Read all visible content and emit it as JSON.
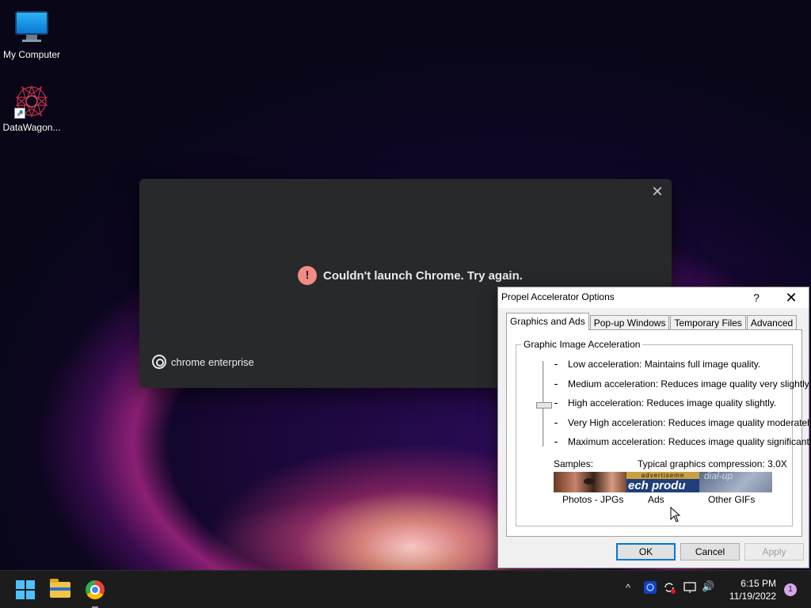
{
  "desktop": {
    "icons": [
      {
        "label": "My Computer",
        "icon": "monitor-icon"
      },
      {
        "label": "DataWagon...",
        "icon": "datawagon-icon"
      }
    ]
  },
  "chrome_error": {
    "message": "Couldn't launch Chrome. Try again.",
    "brand": "chrome enterprise",
    "close": "✕",
    "error_glyph": "!"
  },
  "propel": {
    "title": "Propel Accelerator Options",
    "help": "?",
    "close": "✕",
    "tabs": [
      {
        "label": "Graphics and Ads",
        "active": true
      },
      {
        "label": "Pop-up Windows",
        "active": false
      },
      {
        "label": "Temporary Files",
        "active": false
      },
      {
        "label": "Advanced",
        "active": false
      }
    ],
    "group_title": "Graphic Image Acceleration",
    "levels": [
      "Low acceleration: Maintains full image quality.",
      "Medium acceleration: Reduces image quality very slightly.",
      "High acceleration: Reduces image quality slightly.",
      "Very High acceleration: Reduces image quality moderately.",
      "Maximum acceleration: Reduces image quality significantly."
    ],
    "selected_level_index": 2,
    "samples_label": "Samples:",
    "compression_label": "Typical graphics compression: 3.0X",
    "sample_ads_top": "advertiseme",
    "sample_ads_big": "ech produ",
    "sample_gif_text": "dial-up",
    "sample_captions": [
      "Photos - JPGs",
      "Ads",
      "Other GIFs"
    ],
    "buttons": {
      "ok": "OK",
      "cancel": "Cancel",
      "apply": "Apply"
    }
  },
  "taskbar": {
    "time": "6:15 PM",
    "date": "11/19/2022",
    "notification_count": "1",
    "tray_chevron": "^",
    "tray_volume": "🔊"
  },
  "colors": {
    "accent": "#0078d7",
    "chrome_bg": "#28292b",
    "error_red": "#f28b82",
    "taskbar": "#1c1c1c"
  }
}
